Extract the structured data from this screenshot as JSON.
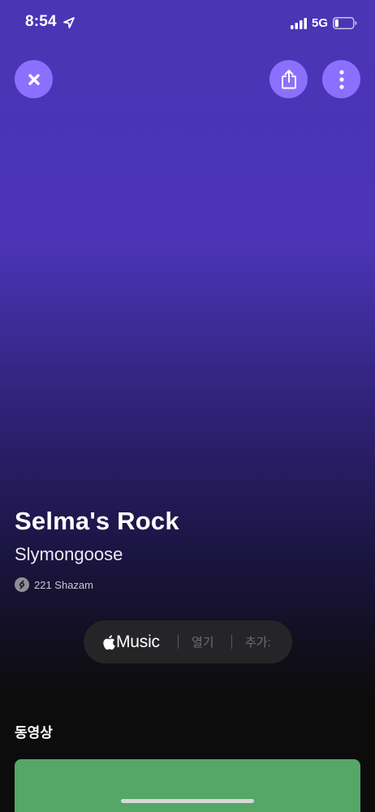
{
  "status_bar": {
    "time": "8:54",
    "network": "5G",
    "battery_percent": 20,
    "icons": [
      "location-arrow-icon",
      "signal-bars-icon",
      "battery-icon"
    ]
  },
  "top_actions": {
    "close_icon": "close-icon",
    "share_icon": "share-icon",
    "more_icon": "more-vertical-icon"
  },
  "track": {
    "title": "Selma's Rock",
    "artist": "Slymongoose",
    "shazam_count": "221 Shazam"
  },
  "music_pill": {
    "service_label": "Music",
    "open_label": "열기",
    "add_label": "추가:"
  },
  "videos": {
    "heading": "동영상"
  },
  "colors": {
    "gradient_top": "#4a35b5",
    "button_bg": "#8b70ff",
    "pill_bg": "#252427",
    "video_card": "#54a767",
    "page_bg": "#0c0c0d"
  }
}
